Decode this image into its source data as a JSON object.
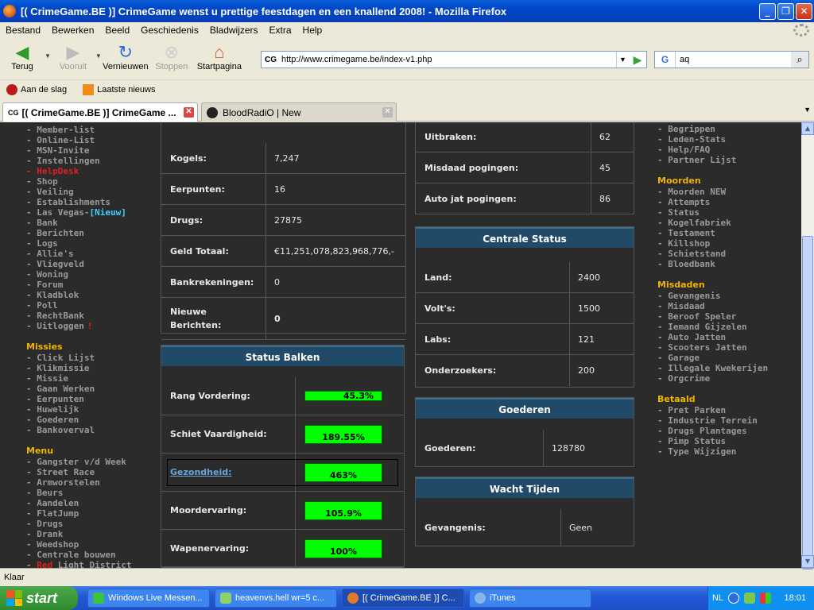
{
  "window": {
    "title": "[( CrimeGame.BE )] CrimeGame wenst u prettige feestdagen en een knallend 2008! - Mozilla Firefox"
  },
  "menu": [
    "Bestand",
    "Bewerken",
    "Beeld",
    "Geschiedenis",
    "Bladwijzers",
    "Extra",
    "Help"
  ],
  "nav": {
    "back": "Terug",
    "forward": "Vooruit",
    "reload": "Vernieuwen",
    "stop": "Stoppen",
    "home": "Startpagina"
  },
  "url": {
    "favicon_text": "CG",
    "value": "http://www.crimegame.be/index-v1.php"
  },
  "search": {
    "value": "aq"
  },
  "bookmarks": [
    "Aan de slag",
    "Laatste nieuws"
  ],
  "tabs": [
    {
      "label": "[( CrimeGame.BE )] CrimeGame ..."
    },
    {
      "label": "BloodRadiO | New"
    }
  ],
  "left_nav": {
    "section1": [
      "- Member-list",
      "- Online-List",
      "- MSN-Invite",
      "- Instellingen",
      "- HelpDesk",
      "- Shop",
      "- Veiling",
      "- Establishments",
      "- Las Vegas-",
      "- Bank",
      "- Berichten",
      "- Logs",
      "- Allie's",
      "- Vliegveld",
      "- Woning",
      "- Forum",
      "- Kladblok",
      "- Poll",
      "- RechtBank",
      "- Uitloggen"
    ],
    "las_vegas_new": "[Nieuw]",
    "uitloggen_mark": "!",
    "missies_title": "Missies",
    "missies": [
      "- Click Lijst",
      "- Klikmissie",
      "- Missie",
      "- Gaan Werken",
      "- Eerpunten",
      "- Huwelijk",
      "- Goederen",
      "- Bankoverval"
    ],
    "menu_title": "Menu",
    "menu": [
      "- Gangster v/d Week",
      "- Street Race",
      "- Armworstelen",
      "- Beurs",
      "- Aandelen",
      "- FlatJump",
      "- Drugs",
      "- Drank",
      "- Weedshop",
      "- Centrale bouwen"
    ],
    "red_light_prefix": "Red",
    "red_light_rest": " Light District"
  },
  "right_nav": {
    "section1": [
      "- Begrippen",
      "- Leden-Stats",
      "- Help/FAQ",
      "- Partner Lijst"
    ],
    "moorden_title": "Moorden",
    "moorden": [
      "- Moorden NEW",
      "- Attempts",
      "- Status",
      "- Kogelfabriek",
      "- Testament",
      "- Killshop",
      "- Schietstand",
      "- Bloedbank"
    ],
    "misdaden_title": "Misdaden",
    "misdaden": [
      "- Gevangenis",
      "- Misdaad",
      "- Beroof Speler",
      "- Iemand Gijzelen",
      "- Auto Jatten",
      "- Scooters Jatten",
      "- Garage",
      "- Illegale Kwekerijen",
      "- Orgcrime"
    ],
    "betaald_title": "Betaald",
    "betaald": [
      "- Pret Parken",
      "- Industrie Terrein",
      "- Drugs Plantages",
      "- Pimp Status",
      "- Type Wijzigen"
    ]
  },
  "stats": [
    {
      "label": "Kogels:",
      "value": "7,247"
    },
    {
      "label": "Eerpunten:",
      "value": "16"
    },
    {
      "label": "Drugs:",
      "value": "27875"
    },
    {
      "label": "Geld Totaal:",
      "value": "€11,251,078,823,968,776,-"
    },
    {
      "label": "Bankrekeningen:",
      "value": "0"
    },
    {
      "label": "Nieuwe Berichten:",
      "value": "0"
    }
  ],
  "status_balken": {
    "title": "Status Balken",
    "bars": [
      {
        "label": "Rang Vordering:",
        "text": "45.3%",
        "fill": 0.453
      },
      {
        "label": "Schiet Vaardigheid:",
        "text": "189.55%",
        "fill": 1.0
      },
      {
        "label": "Gezondheid:",
        "text": "463%",
        "fill": 1.0
      },
      {
        "label": "Moordervaring:",
        "text": "105.9%",
        "fill": 1.0
      },
      {
        "label": "Wapenervaring:",
        "text": "100%",
        "fill": 1.0
      }
    ]
  },
  "mid_top": [
    {
      "label": "Uitbraken:",
      "value": "62"
    },
    {
      "label": "Misdaad pogingen:",
      "value": "45"
    },
    {
      "label": "Auto jat pogingen:",
      "value": "86"
    }
  ],
  "centrale": {
    "title": "Centrale Status",
    "rows": [
      {
        "label": "Land:",
        "value": "2400"
      },
      {
        "label": "Volt's:",
        "value": "1500"
      },
      {
        "label": "Labs:",
        "value": "121"
      },
      {
        "label": "Onderzoekers:",
        "value": "200"
      }
    ]
  },
  "goederen": {
    "title": "Goederen",
    "label": "Goederen:",
    "value": "128780"
  },
  "wacht": {
    "title": "Wacht Tijden",
    "label": "Gevangenis:",
    "value": "Geen"
  },
  "statusbar": "Klaar",
  "taskbar": {
    "start": "start",
    "items": [
      "Windows Live Messen...",
      "heavenvs.hell wr=5 c...",
      "[( CrimeGame.BE )] C...",
      "iTunes"
    ],
    "lang": "NL",
    "clock": "18:01"
  }
}
